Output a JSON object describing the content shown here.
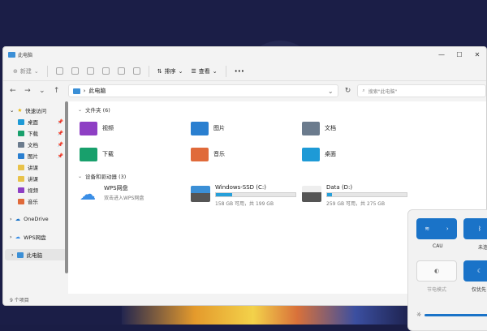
{
  "window": {
    "title": "此电脑"
  },
  "toolbar": {
    "new_label": "新建",
    "sort_label": "排序",
    "view_label": "查看",
    "more_label": "•••"
  },
  "address": {
    "path": "此电脑",
    "search_placeholder": "搜索\"此电脑\""
  },
  "sidebar": {
    "items": [
      {
        "label": "快速访问",
        "pinned": false
      },
      {
        "label": "桌面",
        "pinned": true
      },
      {
        "label": "下载",
        "pinned": true
      },
      {
        "label": "文档",
        "pinned": true
      },
      {
        "label": "图片",
        "pinned": true
      },
      {
        "label": "讲课",
        "pinned": false
      },
      {
        "label": "讲课",
        "pinned": false
      },
      {
        "label": "视频",
        "pinned": false
      },
      {
        "label": "音乐",
        "pinned": false
      },
      {
        "label": "OneDrive",
        "pinned": false
      },
      {
        "label": "WPS网盘",
        "pinned": false
      },
      {
        "label": "此电脑",
        "pinned": false
      }
    ]
  },
  "main": {
    "folders_header": "文件夹 (6)",
    "folders": [
      {
        "label": "视频",
        "color": "#8e3fc4"
      },
      {
        "label": "图片",
        "color": "#2a7fd0"
      },
      {
        "label": "文档",
        "color": "#6b7b8d"
      },
      {
        "label": "下载",
        "color": "#18a06c"
      },
      {
        "label": "音乐",
        "color": "#e06a3a"
      },
      {
        "label": "桌面",
        "color": "#1e9ad6"
      }
    ],
    "drives_header": "设备和驱动器 (3)",
    "wps": {
      "name": "WPS网盘",
      "sub": "双击进入WPS网盘"
    },
    "drives": [
      {
        "name": "Windows-SSD (C:)",
        "usage": "158 GB 可用，共 199 GB",
        "used_fraction": 0.2
      },
      {
        "name": "Data (D:)",
        "usage": "259 GB 可用，共 275 GB",
        "used_fraction": 0.06
      }
    ]
  },
  "status": {
    "count": "9 个项目"
  },
  "quick_settings": {
    "tile1_label": "CAU",
    "tile2_label": "未连",
    "tile3_label": "节电模式",
    "tile4_label": "仅优先",
    "accent": "#1a73c8"
  }
}
